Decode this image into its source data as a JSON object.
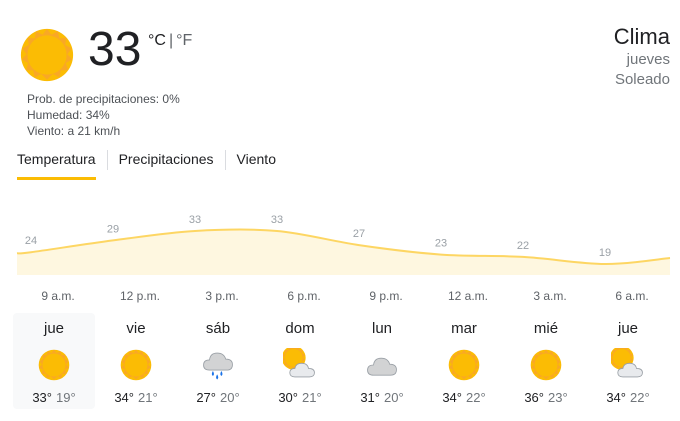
{
  "current": {
    "icon": "sun-icon",
    "temperature": "33",
    "unit_c": "°C",
    "unit_sep": "|",
    "unit_f": "°F",
    "precipitation": "Prob. de precipitaciones: 0%",
    "humidity": "Humedad: 34%",
    "wind": "Viento: a 21 km/h"
  },
  "header": {
    "title": "Clima",
    "day": "jueves",
    "condition": "Soleado"
  },
  "tabs": [
    {
      "label": "Temperatura",
      "active": true
    },
    {
      "label": "Precipitaciones",
      "active": false
    },
    {
      "label": "Viento",
      "active": false
    }
  ],
  "chart_data": {
    "type": "area",
    "x": [
      "9 a.m.",
      "12 p.m.",
      "3 p.m.",
      "6 p.m.",
      "9 p.m.",
      "12 a.m.",
      "3 a.m.",
      "6 a.m."
    ],
    "values": [
      24,
      29,
      33,
      33,
      27,
      23,
      22,
      19
    ],
    "colors": {
      "fill": "#fef7e0",
      "line": "#fdd663"
    }
  },
  "days": [
    {
      "name": "jue",
      "icon": "sun-icon",
      "high": "33°",
      "low": "19°",
      "selected": true
    },
    {
      "name": "vie",
      "icon": "sun-icon",
      "high": "34°",
      "low": "21°",
      "selected": false
    },
    {
      "name": "sáb",
      "icon": "rain-cloud-icon",
      "high": "27°",
      "low": "20°",
      "selected": false
    },
    {
      "name": "dom",
      "icon": "partly-cloudy-icon",
      "high": "30°",
      "low": "21°",
      "selected": false
    },
    {
      "name": "lun",
      "icon": "cloud-icon",
      "high": "31°",
      "low": "20°",
      "selected": false
    },
    {
      "name": "mar",
      "icon": "sun-icon",
      "high": "34°",
      "low": "22°",
      "selected": false
    },
    {
      "name": "mié",
      "icon": "sun-icon",
      "high": "36°",
      "low": "23°",
      "selected": false
    },
    {
      "name": "jue",
      "icon": "partly-cloudy-icon",
      "high": "34°",
      "low": "22°",
      "selected": false
    }
  ]
}
